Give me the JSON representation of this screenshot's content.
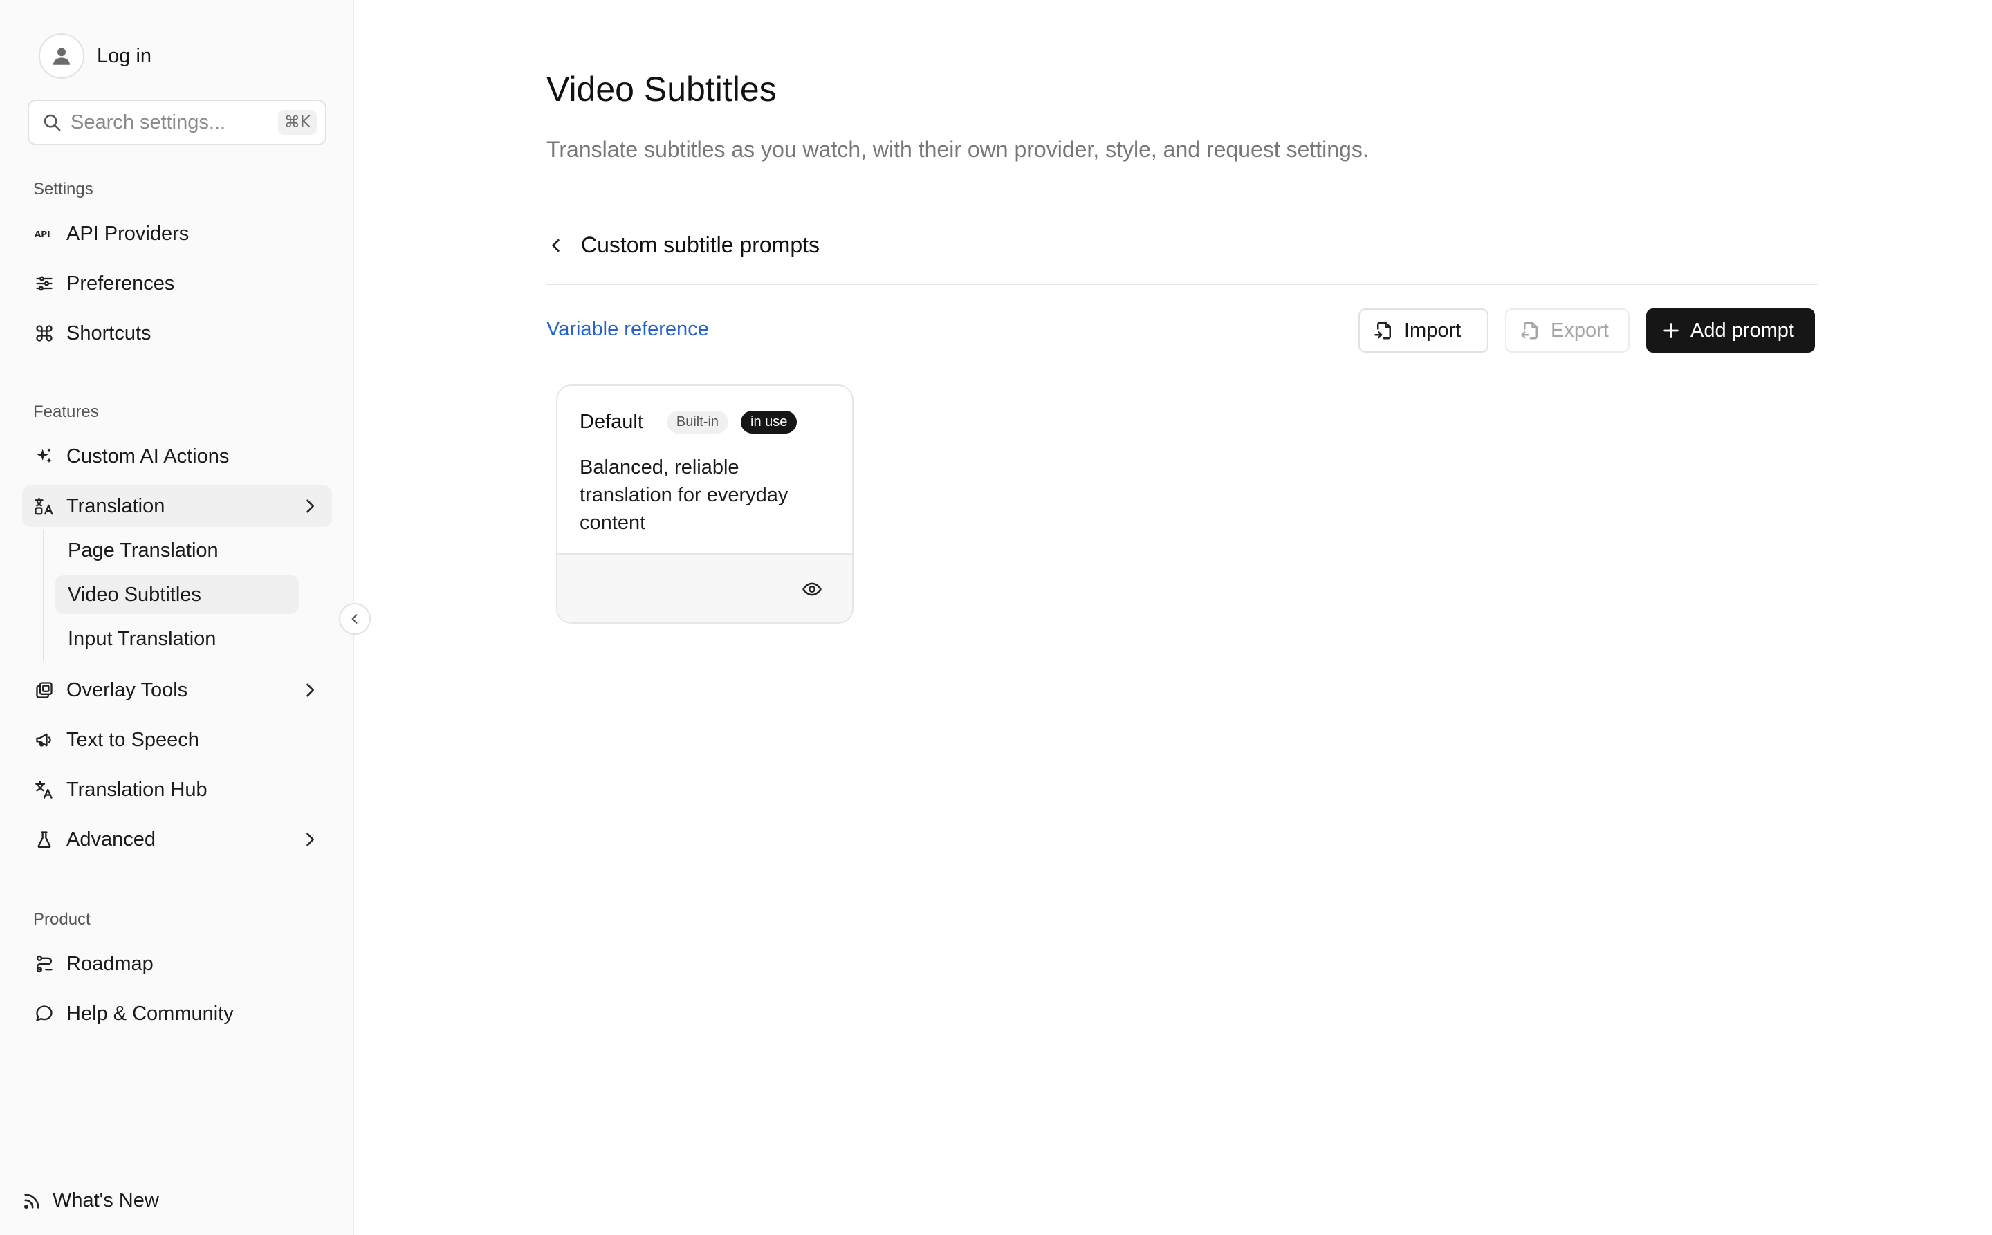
{
  "sidebar": {
    "login_label": "Log in",
    "search": {
      "placeholder": "Search settings...",
      "shortcut": "⌘K"
    },
    "sections": {
      "settings": "Settings",
      "features": "Features",
      "product": "Product"
    },
    "settings_items": [
      {
        "label": "API Providers",
        "icon": "api-icon"
      },
      {
        "label": "Preferences",
        "icon": "sliders-icon"
      },
      {
        "label": "Shortcuts",
        "icon": "command-icon"
      }
    ],
    "feature_items": [
      {
        "label": "Custom AI Actions",
        "icon": "sparkles-icon"
      },
      {
        "label": "Translation",
        "icon": "translate-icon",
        "expanded": true,
        "active": true
      },
      {
        "label": "Overlay Tools",
        "icon": "overlay-icon"
      },
      {
        "label": "Text to Speech",
        "icon": "megaphone-icon"
      },
      {
        "label": "Translation Hub",
        "icon": "language-icon"
      },
      {
        "label": "Advanced",
        "icon": "flask-icon"
      }
    ],
    "translation_sub_items": [
      {
        "label": "Page Translation"
      },
      {
        "label": "Video Subtitles",
        "active": true
      },
      {
        "label": "Input Translation"
      }
    ],
    "product_items": [
      {
        "label": "Roadmap",
        "icon": "route-icon"
      },
      {
        "label": "Help & Community",
        "icon": "chat-icon"
      }
    ],
    "whats_new": "What's New"
  },
  "main": {
    "title": "Video Subtitles",
    "subtitle": "Translate subtitles as you watch, with their own provider, style, and request settings.",
    "section_heading": "Custom subtitle prompts",
    "variable_reference": "Variable reference",
    "buttons": {
      "import": "Import",
      "export": "Export",
      "add": "Add prompt"
    },
    "cards": [
      {
        "name": "Default",
        "badge_builtin": "Built-in",
        "badge_in_use": "in use",
        "description": "Balanced, reliable translation for everyday content"
      }
    ]
  },
  "colors": {
    "accent_link": "#2563c9",
    "primary_button": "#161616",
    "sidebar_bg": "#fafafa"
  }
}
